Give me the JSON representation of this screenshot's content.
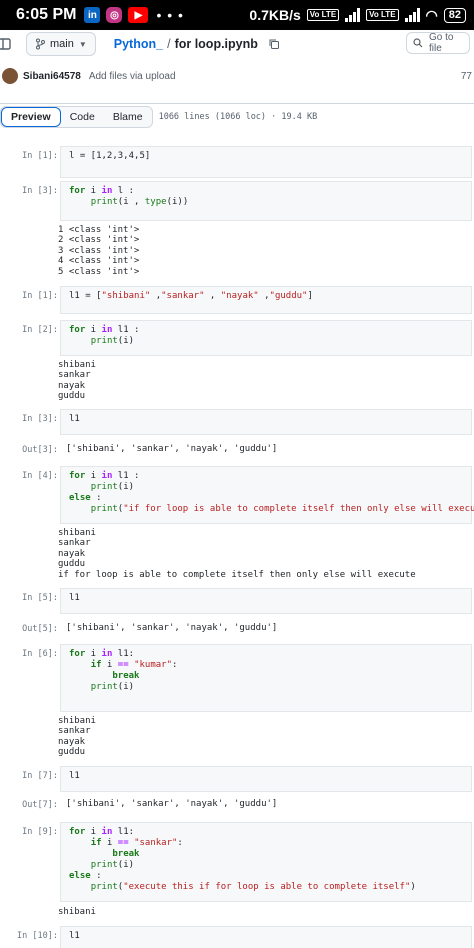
{
  "status_bar": {
    "time": "6:05 PM",
    "app_icons": [
      "linkedin-icon",
      "instagram-icon",
      "youtube-icon"
    ],
    "more": "• • •",
    "network_speed": "0.7KB/s",
    "volte_1": "Vo LTE",
    "volte_2": "Vo LTE",
    "battery": "82"
  },
  "repo_header": {
    "branch": "main",
    "repo": "Python_",
    "separator": "/",
    "file": "for loop.ipynb",
    "goto_placeholder": "Go to file"
  },
  "commit": {
    "author": "Sibani64578",
    "message": "Add files via upload",
    "hash_partial": "77"
  },
  "view_tabs": {
    "preview": "Preview",
    "code": "Code",
    "blame": "Blame",
    "file_info": "1066 lines (1066 loc) · 19.4 KB"
  },
  "cells": [
    {
      "prompt": "In [1]:",
      "code": "l = [1,2,3,4,5]"
    },
    {
      "prompt": "In [3]:",
      "code": "for i in l :\n    print(i , type(i))",
      "output": "1 <class 'int'>\n2 <class 'int'>\n3 <class 'int'>\n4 <class 'int'>\n5 <class 'int'>"
    },
    {
      "prompt": "In [1]:",
      "code": "l1 = [\"shibani\" ,\"sankar\" , \"nayak\" ,\"guddu\"]"
    },
    {
      "prompt": "In [2]:",
      "code": "for i in l1 :\n    print(i)",
      "output": "shibani\nsankar\nnayak\nguddu"
    },
    {
      "prompt": "In [3]:",
      "code": "l1",
      "out_prompt": "Out[3]:",
      "out_value": "['shibani', 'sankar', 'nayak', 'guddu']"
    },
    {
      "prompt": "In [4]:",
      "code": "for i in l1 :\n    print(i)\nelse :\n    print(\"if for loop is able to complete itself then only else will execute\")",
      "output": "shibani\nsankar\nnayak\nguddu\nif for loop is able to complete itself then only else will execute"
    },
    {
      "prompt": "In [5]:",
      "code": "l1",
      "out_prompt": "Out[5]:",
      "out_value": "['shibani', 'sankar', 'nayak', 'guddu']"
    },
    {
      "prompt": "In [6]:",
      "code": "for i in l1:\n    if i == \"kumar\":\n        break\n    print(i)",
      "output": "shibani\nsankar\nnayak\nguddu"
    },
    {
      "prompt": "In [7]:",
      "code": "l1",
      "out_prompt": "Out[7]:",
      "out_value": "['shibani', 'sankar', 'nayak', 'guddu']"
    },
    {
      "prompt": "In [9]:",
      "code": "for i in l1:\n    if i == \"sankar\":\n        break\n    print(i)\nelse :\n    print(\"execute this if for loop is able to complete itself\")",
      "output": "shibani"
    },
    {
      "prompt": "In [10]:",
      "code": "l1"
    }
  ]
}
